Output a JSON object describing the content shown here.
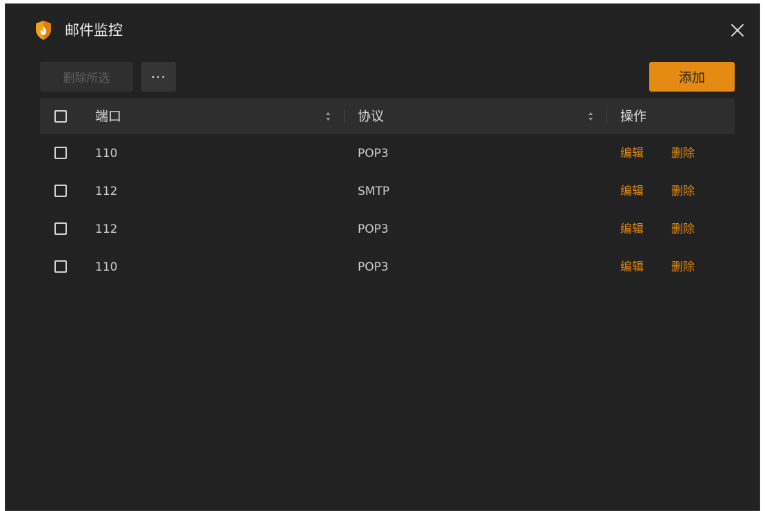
{
  "window": {
    "title": "邮件监控"
  },
  "toolbar": {
    "delete_selected_label": "删除所选",
    "more_label": "···",
    "add_label": "添加"
  },
  "table": {
    "columns": {
      "port": "端口",
      "protocol": "协议",
      "actions": "操作"
    },
    "rows": [
      {
        "port": "110",
        "protocol": "POP3",
        "edit": "编辑",
        "delete": "删除"
      },
      {
        "port": "112",
        "protocol": "SMTP",
        "edit": "编辑",
        "delete": "删除"
      },
      {
        "port": "112",
        "protocol": "POP3",
        "edit": "编辑",
        "delete": "删除"
      },
      {
        "port": "110",
        "protocol": "POP3",
        "edit": "编辑",
        "delete": "删除"
      }
    ]
  },
  "colors": {
    "accent": "#e58b12",
    "background": "#222222",
    "header_background": "#2e2e2e"
  },
  "icons": {
    "logo": "shield-flame-icon",
    "close": "close-icon",
    "sort": "sort-icon",
    "checkbox": "checkbox-icon"
  }
}
